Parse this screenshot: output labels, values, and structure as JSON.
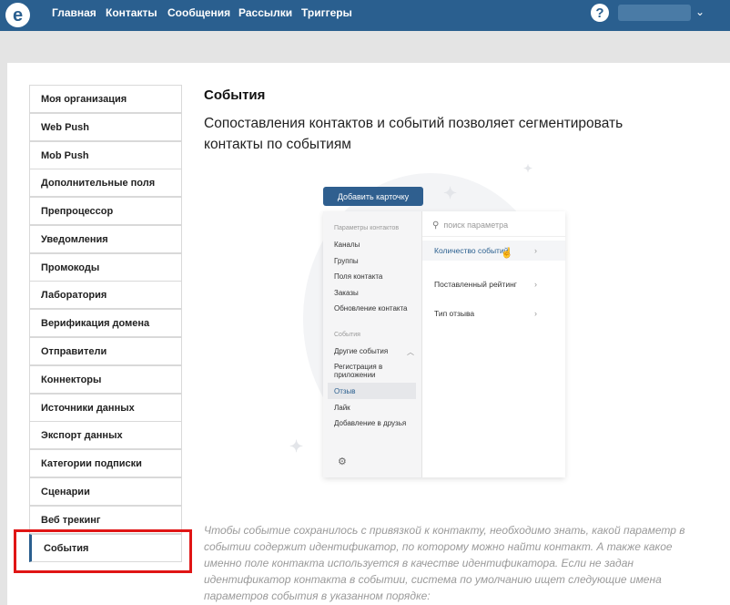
{
  "topbar": {
    "logo": "e",
    "nav": [
      "Главная",
      "Контакты",
      "Сообщения",
      "Рассылки",
      "Триггеры"
    ],
    "help_icon": "?",
    "chevron_icon": "⌄"
  },
  "sidebar": {
    "items": [
      "Моя организация",
      "Web Push",
      "Mob Push",
      "Дополнительные поля",
      "Препроцессор",
      "Уведомления",
      "Промокоды",
      "Лаборатория",
      "Верификация домена",
      "Отправители",
      "Коннекторы",
      "Источники данных",
      "Экспорт данных",
      "Категории подписки",
      "Сценарии",
      "Веб трекинг",
      "События"
    ],
    "active": "События",
    "highlight_color": "#e01515"
  },
  "main": {
    "title": "События",
    "subtitle": "Сопоставления контактов и событий позволяет сегментировать контакты по событиям",
    "illustration": {
      "button": "Добавить карточку",
      "left_groups": {
        "contacts_header": "Параметры контактов",
        "contacts": [
          "Каналы",
          "Группы",
          "Поля контакта",
          "Заказы",
          "Обновление контакта"
        ],
        "events_header": "События",
        "events": [
          "Другие события",
          "Регистрация в\nприложении",
          "Отзыв",
          "Лайк",
          "Добавление в друзья"
        ]
      },
      "search_placeholder": "поиск параметра",
      "params": [
        "Количество событий",
        "Поставленный рейтинг",
        "Тип отзыва"
      ]
    },
    "note": "Чтобы событие сохранилось с привязкой к контакту, необходимо знать, какой параметр в событии содержит идентификатор, по которому можно найти контакт. А также какое именно поле контакта используется в качестве идентификатора. Если не задан идентификатор контакта в событии, система по умолчанию ищет следующие имена параметров события в указанном порядке:"
  },
  "colors": {
    "topbar": "#2a5f8f",
    "accent": "#2a5f8f",
    "background": "#e4e4e4"
  }
}
